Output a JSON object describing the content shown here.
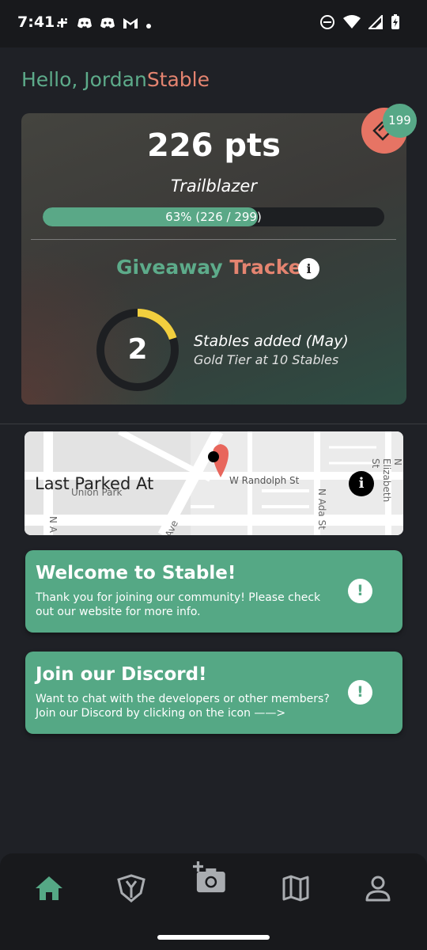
{
  "status_bar": {
    "time": "7:41",
    "left_icons": [
      "slack-icon",
      "discord-icon",
      "discord-icon",
      "gmail-icon",
      "dot-icon"
    ],
    "right_icons": [
      "dnd-icon",
      "wifi-icon",
      "signal-icon",
      "battery-icon"
    ]
  },
  "greeting": {
    "prefix": "Hello, Jordan",
    "suffix": "Stable"
  },
  "badge": {
    "count": "199"
  },
  "points_card": {
    "points": "226 pts",
    "tier": "Trailblazer",
    "progress": {
      "label": "63% (226 / 299)",
      "fraction": 0.63
    },
    "giveaway_title_a": "Giveaway",
    "giveaway_title_b": "Tracker",
    "ring": {
      "value": "2",
      "fraction": 0.2
    },
    "stables_added": "Stables added (May)",
    "gold_tier": "Gold Tier at 10 Stables"
  },
  "map_card": {
    "label": "Last Parked At",
    "streets": {
      "randolph": "W Randolph St",
      "ada": "N Ada St",
      "elizabeth": "N Elizabeth St",
      "union_park": "Union Park",
      "ave": "Ave",
      "n_a": "N A"
    }
  },
  "cards": [
    {
      "title": "Welcome to Stable!",
      "body": "Thank you for joining our community! Please check out our website for more info."
    },
    {
      "title": "Join our Discord!",
      "body": "Want to chat with the developers or other members? Join our Discord by clicking on the icon ——>"
    }
  ],
  "colors": {
    "accent_green": "#55a885",
    "accent_red": "#e67464",
    "progress_yellow": "#f2cf3e"
  },
  "bottom_nav": [
    "home-icon",
    "stable-icon",
    "add-photo-icon",
    "map-icon",
    "profile-icon"
  ]
}
